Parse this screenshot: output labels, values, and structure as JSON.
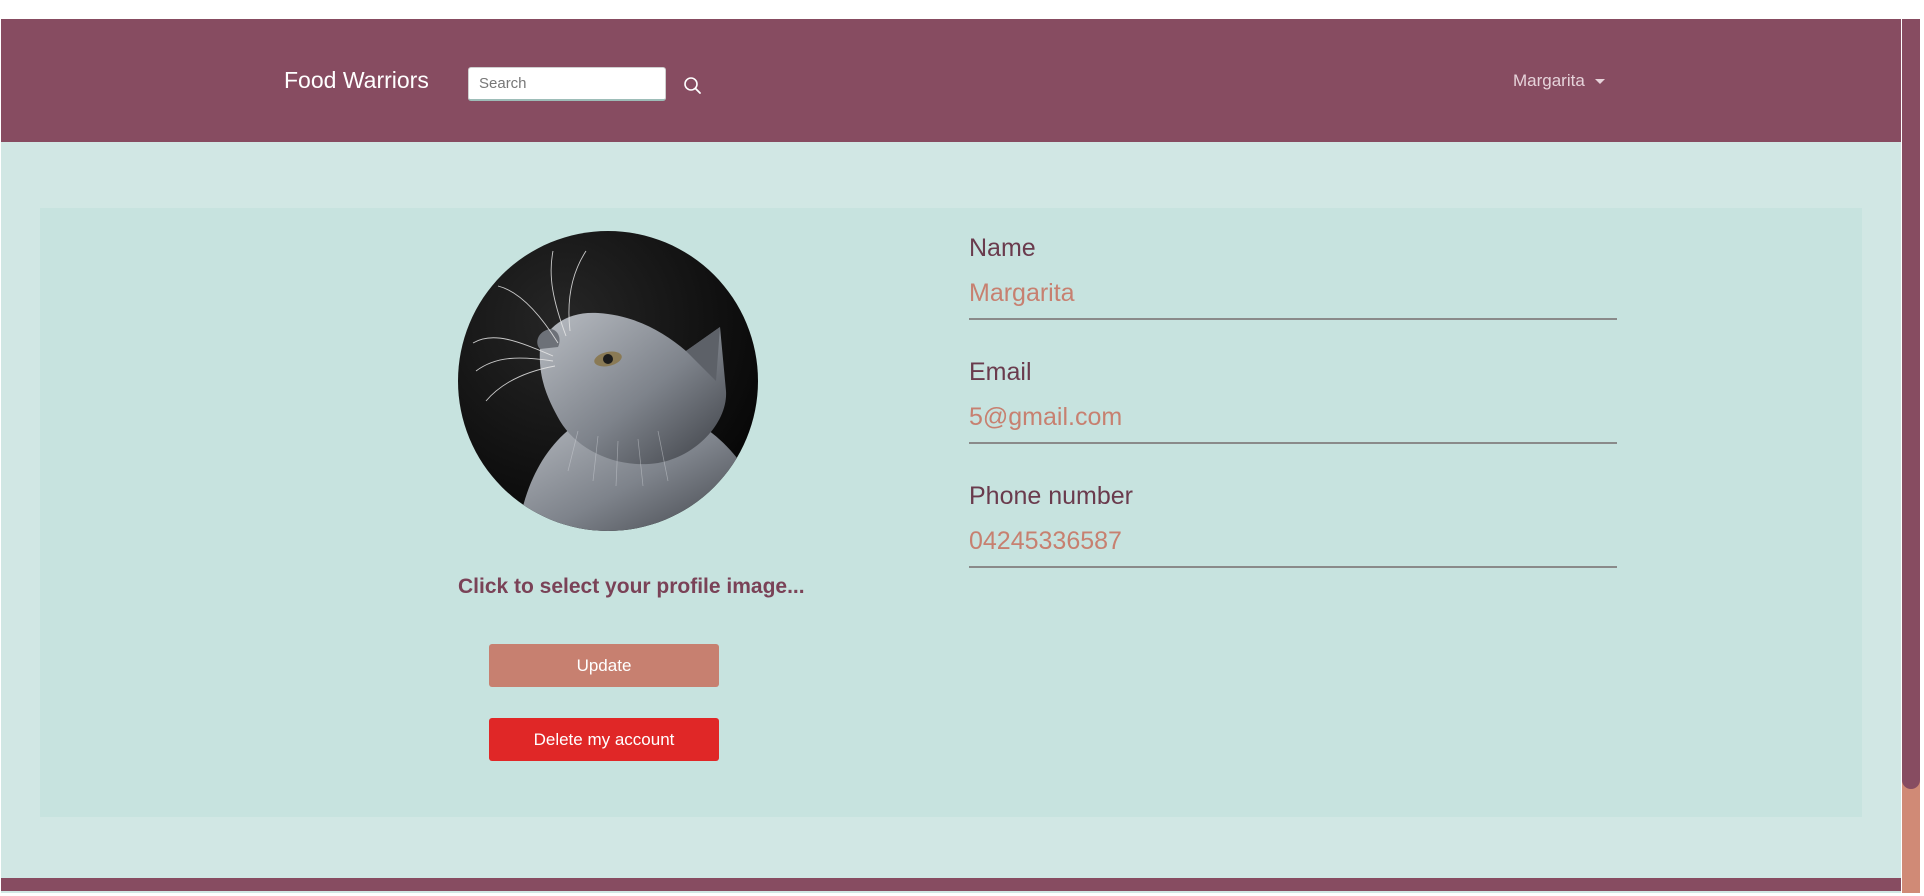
{
  "navbar": {
    "brand": "Food Warriors",
    "search_placeholder": "Search",
    "search_icon": "search-icon",
    "user_name": "Margarita",
    "user_menu_icon": "caret-down-icon"
  },
  "profile": {
    "image_alt": "Profile photo of a grey cat looking up",
    "select_image_label": "Click to select your profile image...",
    "update_label": "Update",
    "delete_label": "Delete my account"
  },
  "fields": [
    {
      "label": "Name",
      "value": "Margarita"
    },
    {
      "label": "Email",
      "value": "5@gmail.com"
    },
    {
      "label": "Phone number",
      "value": "04245336587"
    }
  ],
  "colors": {
    "brand": "#874c61",
    "page_background": "#d1e7e4",
    "card_background": "#c7e3df",
    "accent": "#c78070",
    "danger": "#e02727",
    "label": "#6a3b4d"
  }
}
